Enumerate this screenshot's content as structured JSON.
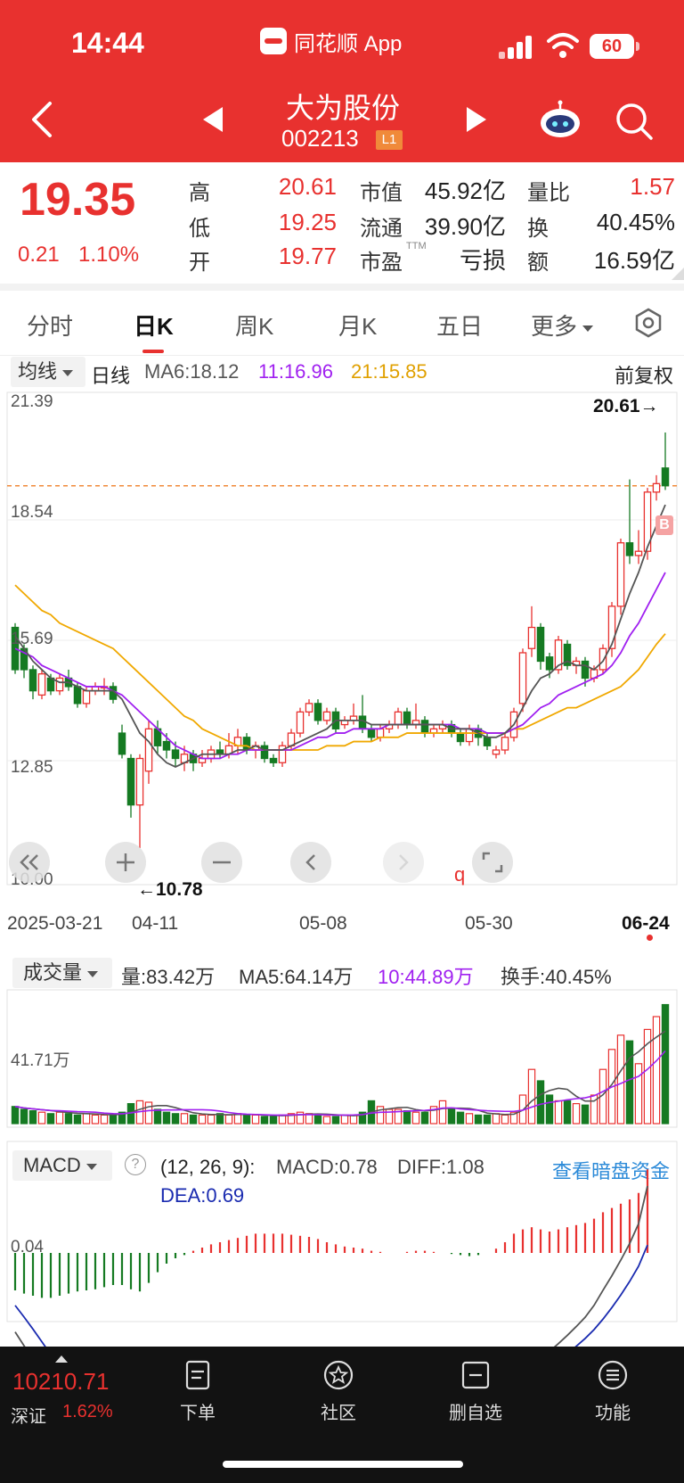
{
  "status": {
    "time": "14:44",
    "app_name": "同花顺 App",
    "battery": "60"
  },
  "header": {
    "stock_name": "大为股份",
    "stock_code": "002213",
    "level_badge": "L1"
  },
  "quote": {
    "price": "19.35",
    "change": "0.21",
    "change_pct": "1.10%",
    "rows": [
      [
        {
          "label": "高",
          "value": "20.61",
          "color": "red"
        },
        {
          "label": "市值",
          "value": "45.92亿",
          "color": "blk"
        },
        {
          "label": "量比",
          "value": "1.57",
          "color": "red"
        }
      ],
      [
        {
          "label": "低",
          "value": "19.25",
          "color": "red"
        },
        {
          "label": "流通",
          "value": "39.90亿",
          "color": "blk"
        },
        {
          "label": "换",
          "value": "40.45%",
          "color": "blk"
        }
      ],
      [
        {
          "label": "开",
          "value": "19.77",
          "color": "red"
        },
        {
          "label": "市盈",
          "value": "亏损",
          "color": "blk"
        },
        {
          "label": "额",
          "value": "16.59亿",
          "color": "blk"
        }
      ]
    ],
    "ttm_tag": "TTM"
  },
  "tabs": [
    "分时",
    "日K",
    "周K",
    "月K",
    "五日",
    "更多"
  ],
  "active_tab": "日K",
  "ma_bar": {
    "toggle": "均线",
    "period": "日线",
    "ma6": "MA6:18.12",
    "ma11": "11:16.96",
    "ma21": "21:15.85",
    "adjust": "前复权",
    "colors": {
      "ma6": "#555555",
      "ma11": "#a020f0",
      "ma21": "#f0a800"
    }
  },
  "kline": {
    "y_ticks": [
      "21.39",
      "18.54",
      "15.69",
      "12.85",
      "10.00"
    ],
    "high_mark": "20.61→",
    "low_mark": "←10.78",
    "buy_mark": "B",
    "q_mark": "q",
    "dates": [
      "2025-03-21",
      "04-11",
      "05-08",
      "05-30",
      "06-24"
    ]
  },
  "volume": {
    "toggle": "成交量",
    "vol": "量:83.42万",
    "ma5": "MA5:64.14万",
    "ma10": "10:44.89万",
    "turnover": "换手:40.45%",
    "y_tick": "41.71万"
  },
  "macd": {
    "toggle": "MACD",
    "help": "?",
    "params": "(12, 26, 9):",
    "macd": "MACD:0.78",
    "diff": "DIFF:1.08",
    "dea": "DEA:0.69",
    "link": "查看暗盘资金",
    "y_tick": "0.04"
  },
  "bottom": {
    "index_value": "10210.71",
    "index_name": "深证",
    "index_pct": "1.62%",
    "nav": [
      "下单",
      "社区",
      "删自选",
      "功能"
    ]
  },
  "chart_data": {
    "type": "candlestick",
    "title": "大为股份 日K",
    "x_range": [
      "2025-03-21",
      "2025-06-24"
    ],
    "ylim": [
      10.0,
      21.39
    ],
    "candles": [
      [
        16.0,
        15.0,
        16.1,
        14.9
      ],
      [
        15.5,
        15.0,
        15.6,
        14.8
      ],
      [
        15.0,
        14.5,
        15.1,
        14.3
      ],
      [
        14.4,
        14.9,
        15.0,
        14.3
      ],
      [
        14.8,
        14.5,
        14.9,
        14.4
      ],
      [
        14.5,
        14.8,
        14.9,
        14.4
      ],
      [
        14.8,
        14.6,
        15.0,
        14.5
      ],
      [
        14.6,
        14.2,
        14.7,
        14.1
      ],
      [
        14.2,
        14.5,
        14.6,
        14.1
      ],
      [
        14.5,
        14.6,
        14.7,
        14.4
      ],
      [
        14.6,
        14.6,
        14.8,
        14.4
      ],
      [
        14.6,
        14.3,
        14.7,
        14.2
      ],
      [
        13.5,
        13.0,
        13.7,
        12.9
      ],
      [
        12.9,
        11.8,
        13.0,
        11.5
      ],
      [
        11.8,
        12.9,
        13.0,
        10.78
      ],
      [
        12.6,
        13.6,
        13.8,
        12.3
      ],
      [
        13.6,
        13.2,
        13.8,
        13.0
      ],
      [
        13.3,
        13.1,
        13.5,
        12.9
      ],
      [
        13.1,
        12.9,
        13.3,
        12.7
      ],
      [
        12.8,
        13.0,
        13.2,
        12.6
      ],
      [
        13.0,
        12.8,
        13.1,
        12.6
      ],
      [
        12.8,
        12.9,
        13.1,
        12.7
      ],
      [
        12.9,
        13.1,
        13.2,
        12.8
      ],
      [
        13.1,
        13.0,
        13.3,
        12.9
      ],
      [
        13.0,
        13.2,
        13.5,
        12.9
      ],
      [
        13.2,
        13.4,
        13.6,
        13.0
      ],
      [
        13.4,
        13.1,
        13.5,
        13.0
      ],
      [
        13.1,
        13.2,
        13.3,
        12.9
      ],
      [
        13.2,
        12.9,
        13.3,
        12.8
      ],
      [
        12.9,
        12.8,
        13.0,
        12.7
      ],
      [
        12.8,
        13.2,
        13.3,
        12.7
      ],
      [
        13.2,
        13.5,
        13.6,
        13.1
      ],
      [
        13.5,
        14.0,
        14.1,
        13.4
      ],
      [
        14.0,
        14.2,
        14.3,
        13.9
      ],
      [
        14.2,
        13.8,
        14.3,
        13.7
      ],
      [
        13.8,
        14.0,
        14.1,
        13.7
      ],
      [
        14.0,
        13.6,
        14.1,
        13.5
      ],
      [
        13.7,
        13.8,
        13.9,
        13.6
      ],
      [
        13.8,
        13.9,
        14.2,
        13.7
      ],
      [
        13.9,
        13.6,
        14.4,
        13.5
      ],
      [
        13.6,
        13.4,
        13.7,
        13.3
      ],
      [
        13.4,
        13.6,
        13.7,
        13.3
      ],
      [
        13.6,
        13.7,
        13.8,
        13.5
      ],
      [
        13.7,
        14.0,
        14.1,
        13.6
      ],
      [
        14.0,
        13.7,
        14.1,
        13.6
      ],
      [
        13.7,
        13.8,
        14.2,
        13.6
      ],
      [
        13.8,
        13.5,
        13.9,
        13.4
      ],
      [
        13.5,
        13.6,
        13.7,
        13.4
      ],
      [
        13.6,
        13.7,
        13.8,
        13.5
      ],
      [
        13.7,
        13.5,
        13.8,
        13.4
      ],
      [
        13.5,
        13.3,
        13.6,
        13.2
      ],
      [
        13.3,
        13.6,
        13.7,
        13.2
      ],
      [
        13.6,
        13.4,
        13.7,
        13.2
      ],
      [
        13.4,
        13.2,
        13.5,
        13.1
      ],
      [
        13.0,
        13.1,
        13.2,
        12.9
      ],
      [
        13.1,
        13.4,
        13.5,
        13.0
      ],
      [
        13.4,
        14.0,
        14.1,
        13.3
      ],
      [
        14.2,
        15.4,
        15.5,
        14.0
      ],
      [
        15.5,
        16.0,
        16.5,
        15.3
      ],
      [
        16.0,
        15.2,
        16.1,
        15.0
      ],
      [
        15.3,
        15.0,
        15.4,
        14.8
      ],
      [
        15.0,
        15.7,
        15.8,
        14.9
      ],
      [
        15.6,
        15.1,
        15.7,
        15.0
      ],
      [
        15.1,
        15.2,
        15.3,
        14.9
      ],
      [
        15.2,
        14.8,
        15.3,
        14.6
      ],
      [
        14.8,
        15.0,
        15.1,
        14.7
      ],
      [
        15.0,
        15.5,
        15.6,
        14.9
      ],
      [
        15.5,
        16.5,
        16.6,
        15.3
      ],
      [
        16.5,
        18.0,
        18.1,
        16.3
      ],
      [
        18.0,
        17.7,
        19.5,
        17.5
      ],
      [
        17.7,
        17.8,
        18.3,
        17.5
      ],
      [
        17.8,
        19.2,
        19.3,
        17.6
      ],
      [
        19.2,
        19.4,
        19.6,
        19.0
      ],
      [
        19.77,
        19.35,
        20.61,
        19.25
      ]
    ],
    "ma6": [
      15.8,
      15.5,
      15.2,
      15.0,
      14.8,
      14.7,
      14.7,
      14.6,
      14.5,
      14.5,
      14.5,
      14.5,
      14.3,
      13.9,
      13.5,
      13.3,
      13.0,
      12.8,
      12.7,
      12.8,
      12.9,
      13.0,
      13.0,
      13.0,
      13.0,
      13.1,
      13.1,
      13.2,
      13.1,
      13.1,
      13.1,
      13.2,
      13.3,
      13.4,
      13.5,
      13.6,
      13.8,
      13.8,
      13.8,
      13.8,
      13.7,
      13.7,
      13.7,
      13.7,
      13.7,
      13.7,
      13.7,
      13.7,
      13.7,
      13.6,
      13.6,
      13.6,
      13.5,
      13.4,
      13.4,
      13.5,
      13.7,
      14.1,
      14.5,
      14.8,
      14.9,
      15.1,
      15.2,
      15.1,
      15.1,
      15.0,
      15.2,
      15.6,
      16.2,
      16.8,
      17.3,
      17.9,
      18.4,
      18.9
    ],
    "ma11": [
      15.5,
      15.4,
      15.3,
      15.1,
      15.0,
      14.9,
      14.8,
      14.7,
      14.6,
      14.6,
      14.6,
      14.5,
      14.4,
      14.2,
      14.0,
      13.8,
      13.6,
      13.4,
      13.2,
      13.1,
      13.0,
      12.9,
      12.9,
      12.9,
      13.0,
      13.0,
      13.1,
      13.1,
      13.1,
      13.1,
      13.1,
      13.1,
      13.2,
      13.3,
      13.4,
      13.4,
      13.5,
      13.5,
      13.6,
      13.6,
      13.6,
      13.6,
      13.7,
      13.7,
      13.7,
      13.7,
      13.7,
      13.7,
      13.7,
      13.7,
      13.6,
      13.6,
      13.6,
      13.5,
      13.5,
      13.5,
      13.6,
      13.7,
      13.9,
      14.1,
      14.2,
      14.4,
      14.5,
      14.6,
      14.7,
      14.8,
      14.9,
      15.1,
      15.4,
      15.8,
      16.1,
      16.5,
      16.9,
      17.3
    ],
    "ma21": [
      17.0,
      16.8,
      16.6,
      16.4,
      16.3,
      16.1,
      16.0,
      15.9,
      15.8,
      15.7,
      15.6,
      15.5,
      15.3,
      15.1,
      14.9,
      14.7,
      14.5,
      14.3,
      14.1,
      13.9,
      13.8,
      13.6,
      13.5,
      13.4,
      13.3,
      13.2,
      13.2,
      13.1,
      13.1,
      13.1,
      13.1,
      13.1,
      13.1,
      13.1,
      13.1,
      13.2,
      13.2,
      13.2,
      13.3,
      13.3,
      13.3,
      13.4,
      13.4,
      13.4,
      13.5,
      13.5,
      13.5,
      13.5,
      13.5,
      13.5,
      13.5,
      13.5,
      13.5,
      13.5,
      13.5,
      13.5,
      13.6,
      13.6,
      13.7,
      13.8,
      13.9,
      14.0,
      14.1,
      14.1,
      14.2,
      14.3,
      14.4,
      14.5,
      14.6,
      14.8,
      15.0,
      15.3,
      15.6,
      15.85
    ],
    "volume": [
      12,
      10,
      9,
      8,
      7,
      8,
      7,
      6,
      7,
      6,
      6,
      6,
      8,
      14,
      16,
      15,
      10,
      8,
      7,
      7,
      6,
      6,
      6,
      7,
      6,
      7,
      6,
      6,
      5,
      5,
      6,
      7,
      8,
      7,
      6,
      5,
      5,
      6,
      6,
      8,
      16,
      12,
      10,
      10,
      9,
      8,
      8,
      12,
      16,
      10,
      8,
      7,
      6,
      6,
      7,
      6,
      8,
      20,
      38,
      30,
      20,
      16,
      16,
      14,
      13,
      20,
      38,
      52,
      62,
      58,
      42,
      66,
      75,
      83.42
    ],
    "macd_hist": [
      -0.35,
      -0.38,
      -0.4,
      -0.42,
      -0.42,
      -0.4,
      -0.38,
      -0.36,
      -0.35,
      -0.34,
      -0.32,
      -0.3,
      -0.3,
      -0.34,
      -0.36,
      -0.28,
      -0.18,
      -0.1,
      -0.05,
      -0.02,
      0.02,
      0.05,
      0.08,
      0.1,
      0.12,
      0.14,
      0.16,
      0.18,
      0.18,
      0.18,
      0.18,
      0.17,
      0.16,
      0.15,
      0.13,
      0.1,
      0.08,
      0.06,
      0.05,
      0.04,
      0.02,
      0.01,
      0.0,
      0.0,
      0.01,
      0.02,
      0.02,
      0.01,
      0.0,
      -0.01,
      -0.02,
      -0.03,
      -0.02,
      0.0,
      0.04,
      0.1,
      0.18,
      0.22,
      0.24,
      0.22,
      0.2,
      0.22,
      0.24,
      0.26,
      0.28,
      0.32,
      0.38,
      0.42,
      0.46,
      0.5,
      0.56,
      0.78
    ]
  }
}
